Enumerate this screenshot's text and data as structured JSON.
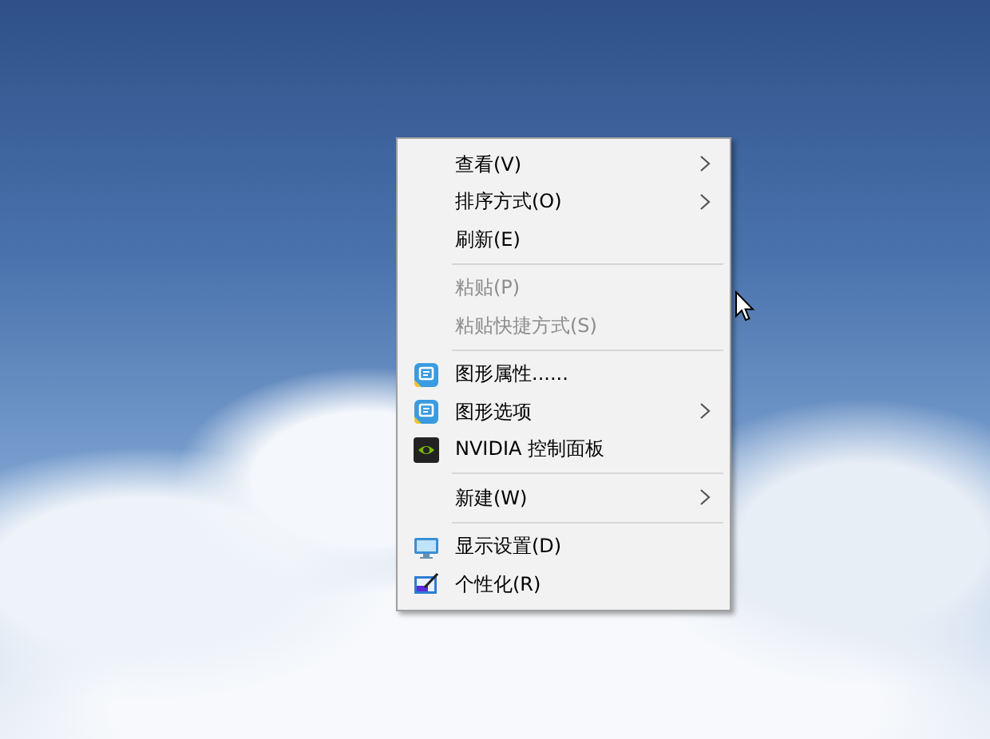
{
  "context_menu": {
    "items": [
      {
        "kind": "plain",
        "label": "查看(V)",
        "disabled": false,
        "submenu": true
      },
      {
        "kind": "plain",
        "label": "排序方式(O)",
        "disabled": false,
        "submenu": true
      },
      {
        "kind": "plain",
        "label": "刷新(E)",
        "disabled": false,
        "submenu": false
      },
      {
        "kind": "separator"
      },
      {
        "kind": "plain",
        "label": "粘贴(P)",
        "disabled": true,
        "submenu": false
      },
      {
        "kind": "plain",
        "label": "粘贴快捷方式(S)",
        "disabled": true,
        "submenu": false
      },
      {
        "kind": "separator"
      },
      {
        "kind": "graphics",
        "label": "图形属性......",
        "disabled": false,
        "submenu": false
      },
      {
        "kind": "graphics",
        "label": "图形选项",
        "disabled": false,
        "submenu": true
      },
      {
        "kind": "nvidia",
        "label": "NVIDIA 控制面板",
        "disabled": false,
        "submenu": false
      },
      {
        "kind": "separator"
      },
      {
        "kind": "plain",
        "label": "新建(W)",
        "disabled": false,
        "submenu": true
      },
      {
        "kind": "separator"
      },
      {
        "kind": "display",
        "label": "显示设置(D)",
        "disabled": false,
        "submenu": false
      },
      {
        "kind": "personalize",
        "label": "个性化(R)",
        "disabled": false,
        "submenu": false
      }
    ]
  }
}
